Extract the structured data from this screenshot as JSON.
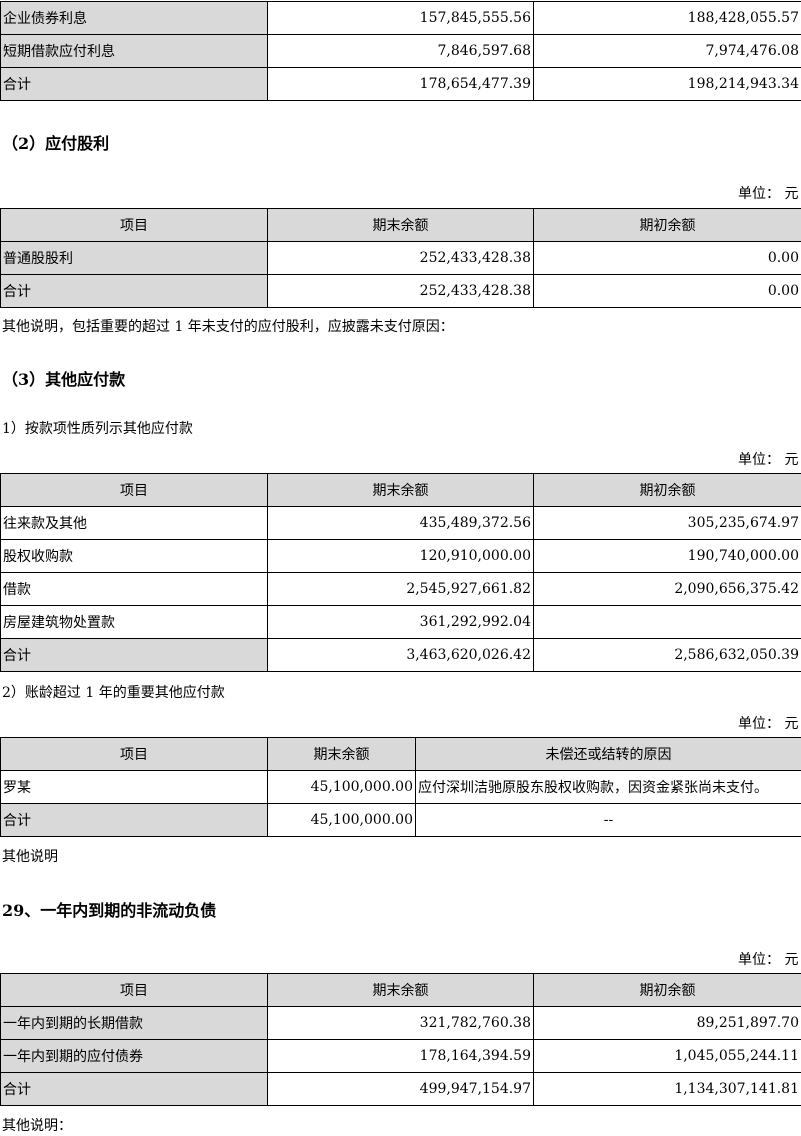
{
  "unit": {
    "label": "单位：",
    "value": "元"
  },
  "table0": {
    "rows": [
      {
        "name": "企业债券利息",
        "end": "157,845,555.56",
        "begin": "188,428,055.57"
      },
      {
        "name": "短期借款应付利息",
        "end": "7,846,597.68",
        "begin": "7,974,476.08"
      },
      {
        "name": "合计",
        "end": "178,654,477.39",
        "begin": "198,214,943.34"
      }
    ]
  },
  "sec2": {
    "title": "（2）应付股利",
    "headers": [
      "项目",
      "期末余额",
      "期初余额"
    ],
    "rows": [
      {
        "name": "普通股股利",
        "end": "252,433,428.38",
        "begin": "0.00"
      },
      {
        "name": "合计",
        "end": "252,433,428.38",
        "begin": "0.00"
      }
    ],
    "note": "其他说明，包括重要的超过 1 年未支付的应付股利，应披露未支付原因："
  },
  "sec3": {
    "title": "（3）其他应付款",
    "sub1": "1）按款项性质列示其他应付款",
    "headers": [
      "项目",
      "期末余额",
      "期初余额"
    ],
    "rows": [
      {
        "name": "往来款及其他",
        "end": "435,489,372.56",
        "begin": "305,235,674.97"
      },
      {
        "name": "股权收购款",
        "end": "120,910,000.00",
        "begin": "190,740,000.00"
      },
      {
        "name": "借款",
        "end": "2,545,927,661.82",
        "begin": "2,090,656,375.42"
      },
      {
        "name": "房屋建筑物处置款",
        "end": "361,292,992.04",
        "begin": ""
      },
      {
        "name": "合计",
        "end": "3,463,620,026.42",
        "begin": "2,586,632,050.39"
      }
    ],
    "sub2": "2）账龄超过 1 年的重要其他应付款",
    "headers2": [
      "项目",
      "期末余额",
      "未偿还或结转的原因"
    ],
    "rows2": [
      {
        "name": "罗某",
        "end": "45,100,000.00",
        "reason": "应付深圳洁驰原股东股权收购款，因资金紧张尚未支付。"
      },
      {
        "name": "合计",
        "end": "45,100,000.00",
        "reason": "--"
      }
    ],
    "note": "其他说明"
  },
  "sec29": {
    "title": "29、一年内到期的非流动负债",
    "headers": [
      "项目",
      "期末余额",
      "期初余额"
    ],
    "rows": [
      {
        "name": "一年内到期的长期借款",
        "end": "321,782,760.38",
        "begin": "89,251,897.70"
      },
      {
        "name": "一年内到期的应付债券",
        "end": "178,164,394.59",
        "begin": "1,045,055,244.11"
      },
      {
        "name": "合计",
        "end": "499,947,154.97",
        "begin": "1,134,307,141.81"
      }
    ],
    "note": "其他说明："
  }
}
